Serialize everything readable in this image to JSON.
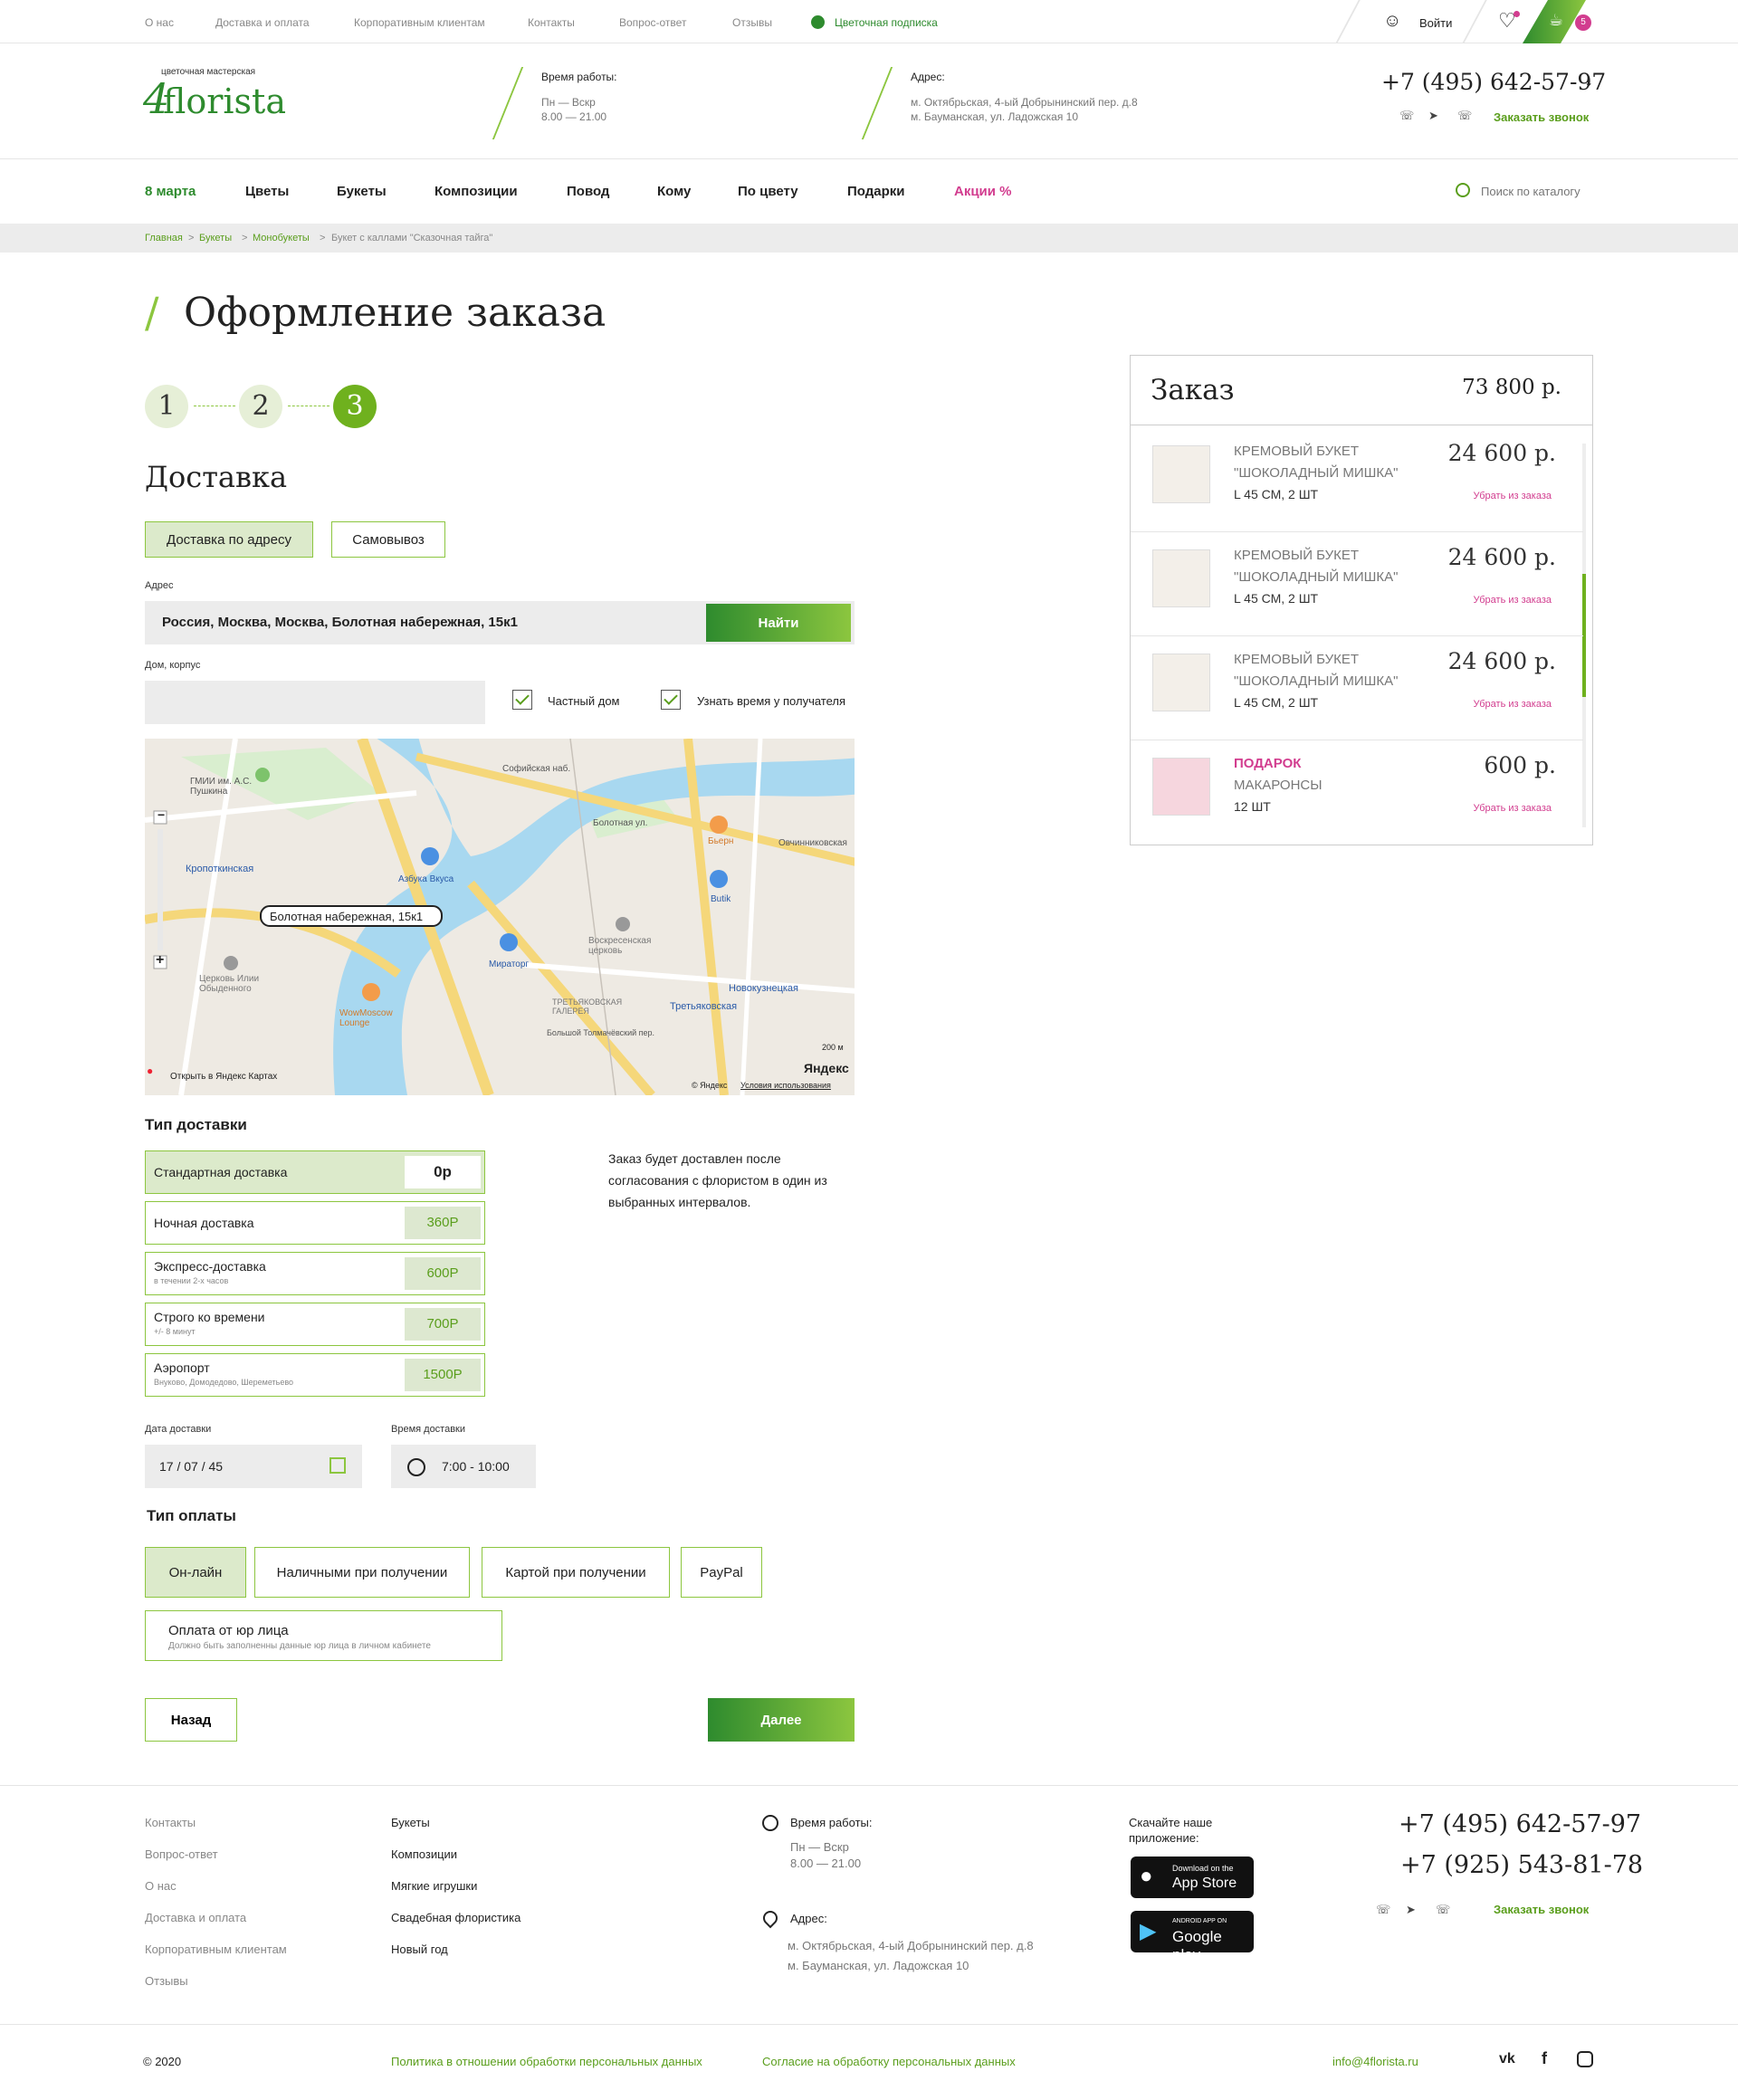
{
  "topbar": {
    "links": [
      "О нас",
      "Доставка и оплата",
      "Корпоративным клиентам",
      "Контакты",
      "Вопрос-ответ",
      "Отзывы"
    ],
    "subscription": "Цветочная подписка",
    "login": "Войти",
    "cart_count": "5"
  },
  "logo": {
    "tagline": "цветочная мастерская",
    "name": "florista",
    "mark": "4"
  },
  "header": {
    "hours_title": "Время работы:",
    "hours_days": "Пн — Вскр",
    "hours_time": "8.00 — 21.00",
    "address_title": "Адрес:",
    "address_1": "м. Октябрьская, 4-ый Добрынинский пер. д.8",
    "address_2": "м. Бауманская, ул. Ладожская 10",
    "phone": "+7 (495) 642-57-97",
    "callback": "Заказать звонок"
  },
  "nav": {
    "items": [
      "8 марта",
      "Цветы",
      "Букеты",
      "Композиции",
      "Повод",
      "Кому",
      "По цвету",
      "Подарки",
      "Акции %"
    ],
    "search_placeholder": "Поиск по каталогу"
  },
  "breadcrumbs": [
    "Главная",
    "Букеты",
    "Монобукеты",
    "Букет с каллами \"Сказочная тайга\""
  ],
  "page": {
    "title": "Оформление заказа",
    "steps": [
      "1",
      "2",
      "3"
    ],
    "section": "Доставка"
  },
  "delivery_mode": {
    "address": "Доставка по адресу",
    "pickup": "Самовывоз"
  },
  "address": {
    "label": "Адрес",
    "value": "Россия, Москва, Москва, Болотная набережная, 15к1",
    "find": "Найти",
    "house_label": "Дом, корпус",
    "house_value": "",
    "private_house": "Частный дом",
    "ask_time": "Узнать время у получателя"
  },
  "map": {
    "pin_label": "Болотная набережная, 15к1",
    "open_link": "Открыть в Яндекс Картах",
    "brand": "Яндекс",
    "terms": "Условия использования",
    "copyright": "© Яндекс",
    "scale": "200 м",
    "labels": [
      "ГМИИ им. А.С. Пушкина",
      "Кропоткинская",
      "Азбука Вкуса",
      "Мираторг",
      "WowMoscow Lounge",
      "Воскресенская церковь",
      "Третьяковская",
      "Новокузнецкая",
      "Бьерн",
      "Butik",
      "Церковь Илии Обыденного",
      "ТРЕТЬЯКОВСКАЯ ГАЛЕРЕЯ",
      "Болотная ул.",
      "Софийская наб.",
      "Овчинниковская",
      "Большой Толмачёвский пер."
    ]
  },
  "delivery_types": {
    "title": "Тип доставки",
    "note": "Заказ будет доставлен после согласования с флористом в один из выбранных интервалов.",
    "items": [
      {
        "name": "Стандартная доставка",
        "sub": "",
        "price": "0р"
      },
      {
        "name": "Ночная доставка",
        "sub": "",
        "price": "360Р"
      },
      {
        "name": "Экспресс-доставка",
        "sub": "в течении 2-х часов",
        "price": "600Р"
      },
      {
        "name": "Строго ко времени",
        "sub": "+/- 8 минут",
        "price": "700Р"
      },
      {
        "name": "Аэропорт",
        "sub": "Внуково, Домодедово, Шереметьево",
        "price": "1500Р"
      }
    ]
  },
  "datetime": {
    "date_label": "Дата доставки",
    "date_value": "17 / 07 / 45",
    "time_label": "Время доставки",
    "time_value": "7:00 - 10:00"
  },
  "payment": {
    "title": "Тип оплаты",
    "options": [
      "Он-лайн",
      "Наличными при получении",
      "Картой при получении",
      "PayPal"
    ],
    "legal": "Оплата от юр лица",
    "legal_sub": "Должно быть заполненны данные юр лица в личном кабинете"
  },
  "actions": {
    "back": "Назад",
    "next": "Далее"
  },
  "order": {
    "title": "Заказ",
    "total": "73 800 р.",
    "remove": "Убрать из заказа",
    "items": [
      {
        "line1": "КРЕМОВЫЙ БУКЕТ",
        "line2": "\"ШОКОЛАДНЫЙ МИШКА\"",
        "line3": "L 45 СМ, 2 ШТ",
        "price": "24 600 р."
      },
      {
        "line1": "КРЕМОВЫЙ БУКЕТ",
        "line2": "\"ШОКОЛАДНЫЙ МИШКА\"",
        "line3": "L 45 СМ, 2 ШТ",
        "price": "24 600 р."
      },
      {
        "line1": "КРЕМОВЫЙ БУКЕТ",
        "line2": "\"ШОКОЛАДНЫЙ МИШКА\"",
        "line3": "L 45 СМ, 2 ШТ",
        "price": "24 600 р."
      },
      {
        "line1": "ПОДАРОК",
        "line2": "МАКАРОНСЫ",
        "line3": "12 ШТ",
        "price": "600 р."
      }
    ]
  },
  "footer": {
    "col1": [
      "Контакты",
      "Вопрос-ответ",
      "О нас",
      "Доставка и оплата",
      "Корпоративным клиентам",
      "Отзывы"
    ],
    "col2": [
      "Букеты",
      "Композиции",
      "Мягкие игрушки",
      "Свадебная флористика",
      "Новый год"
    ],
    "hours_title": "Время работы:",
    "hours_days": "Пн — Вскр",
    "hours_time": "8.00 — 21.00",
    "address_title": "Адрес:",
    "address_1": "м. Октябрьская, 4-ый Добрынинский пер. д.8",
    "address_2": "м. Бауманская, ул. Ладожская 10",
    "app_title": "Скачайте наше приложение:",
    "appstore_small": "Download on the",
    "appstore": "App Store",
    "gplay_small": "ANDROID APP ON",
    "gplay": "Google play",
    "phone1": "+7 (495) 642-57-97",
    "phone2": "+7 (925) 543-81-78",
    "callback": "Заказать звонок",
    "copyright": "© 2020",
    "policy": "Политика в отношении обработки персональных данных",
    "consent": "Согласие на обработку персональных данных",
    "email": "info@4florista.ru"
  },
  "colors": {
    "accent": "#8cc63f",
    "dark_green": "#2e8b2e",
    "pink": "#d23d8f"
  }
}
